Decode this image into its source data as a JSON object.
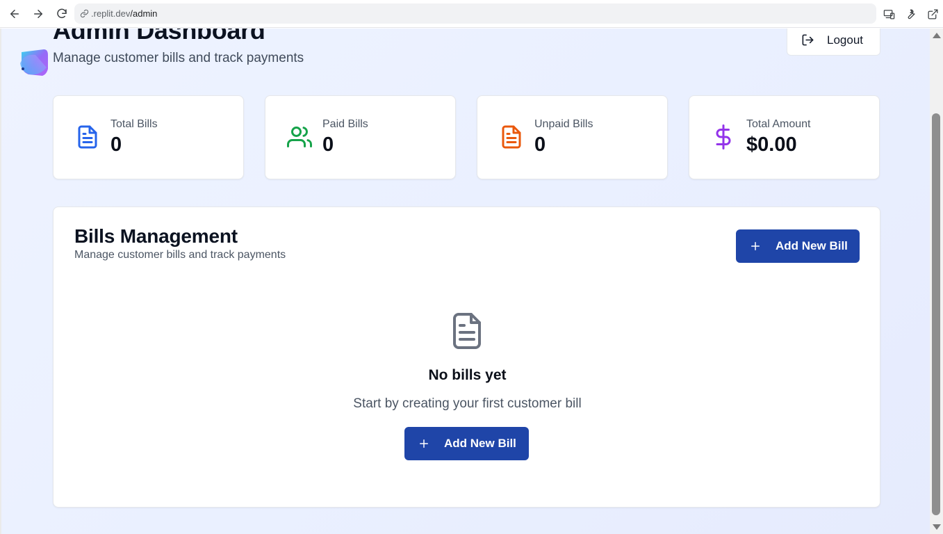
{
  "browser": {
    "url_domain": ".replit.dev",
    "url_path": "/admin",
    "icons": [
      "back-arrow-icon",
      "forward-arrow-icon",
      "reload-icon",
      "link-icon",
      "devices-icon",
      "wrench-icon",
      "open-external-icon"
    ]
  },
  "header": {
    "title": "Admin Dashboard",
    "subtitle": "Manage customer bills and track payments",
    "logout_label": "Logout"
  },
  "stats": [
    {
      "label": "Total Bills",
      "value": "0",
      "icon": "file-text-icon",
      "color": "#2563eb"
    },
    {
      "label": "Paid Bills",
      "value": "0",
      "icon": "users-icon",
      "color": "#16a34a"
    },
    {
      "label": "Unpaid Bills",
      "value": "0",
      "icon": "file-text-icon",
      "color": "#ea580c"
    },
    {
      "label": "Total Amount",
      "value": "$0.00",
      "icon": "dollar-sign-icon",
      "color": "#9333ea"
    }
  ],
  "bills": {
    "title": "Bills Management",
    "subtitle": "Manage customer bills and track payments",
    "add_button_label": "Add New Bill",
    "empty_title": "No bills yet",
    "empty_subtitle": "Start by creating your first customer bill",
    "empty_add_button_label": "Add New Bill"
  },
  "colors": {
    "primary": "#1f45a8",
    "background": "#eaf0ff"
  }
}
